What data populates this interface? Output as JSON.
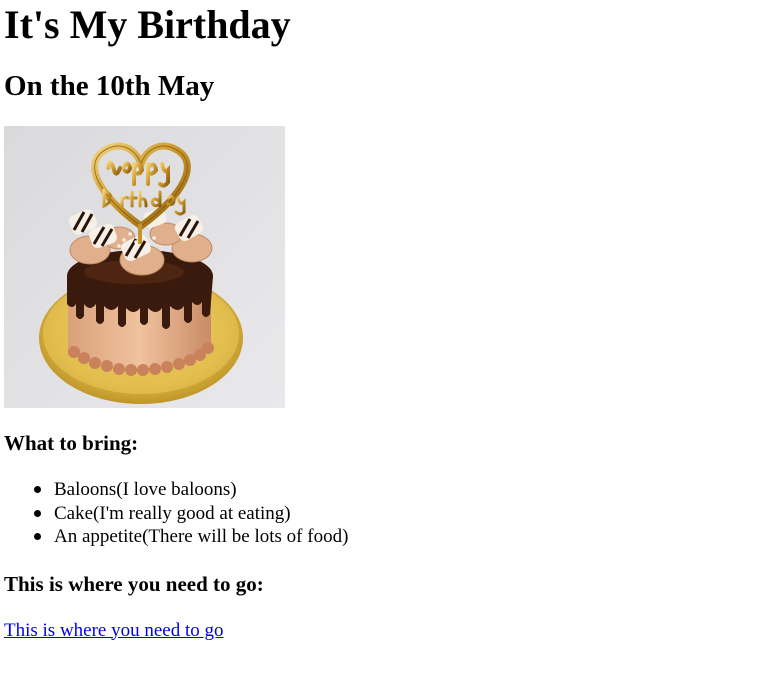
{
  "page": {
    "title": "It's My Birthday",
    "subtitle": "On the 10th May",
    "bring_heading": "What to bring:",
    "bring_items": [
      "Baloons(I love baloons)",
      "Cake(I'm really good at eating)",
      "An appetite(There will be lots of food)"
    ],
    "where_heading": "This is where you need to go:",
    "link_text": "This is where you need to go"
  },
  "colors": {
    "link": "#0000ee",
    "text": "#000000",
    "background": "#ffffff"
  },
  "icons": {
    "cake_image": "birthday-cake-image"
  }
}
